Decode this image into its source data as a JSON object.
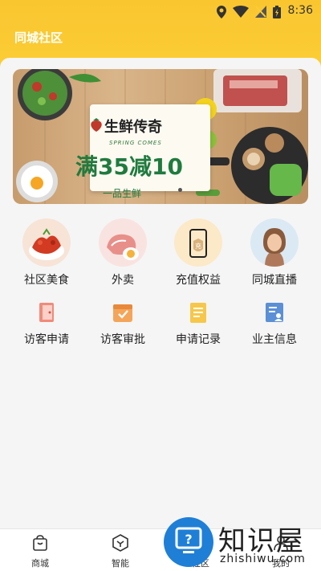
{
  "status_bar": {
    "time": "8:36"
  },
  "header": {
    "title": "同城社区"
  },
  "banner": {
    "brand": "生鲜传奇",
    "sub": "SPRING COMES",
    "promo": "满35减10",
    "tag": "一品生鲜"
  },
  "services": [
    {
      "label": "社区美食",
      "icon": "food-icon"
    },
    {
      "label": "外卖",
      "icon": "takeout-icon"
    },
    {
      "label": "充值权益",
      "icon": "recharge-icon"
    },
    {
      "label": "同城直播",
      "icon": "live-icon"
    }
  ],
  "tools": [
    {
      "label": "访客申请",
      "icon": "visitor-apply-icon"
    },
    {
      "label": "访客审批",
      "icon": "visitor-approve-icon"
    },
    {
      "label": "申请记录",
      "icon": "records-icon"
    },
    {
      "label": "业主信息",
      "icon": "owner-info-icon"
    }
  ],
  "bottom_nav": [
    {
      "label": "商城",
      "icon": "shopping-bag-icon"
    },
    {
      "label": "智能",
      "icon": "smart-icon"
    },
    {
      "label": "社区",
      "icon": "community-icon"
    },
    {
      "label": "我的",
      "icon": "profile-icon"
    }
  ],
  "watermark": {
    "text": "知识屋",
    "url": "zhishiwu.com"
  },
  "colors": {
    "header": "#fccd35",
    "accent_green": "#1f7b3e",
    "watermark_blue": "#1f7fd6"
  }
}
